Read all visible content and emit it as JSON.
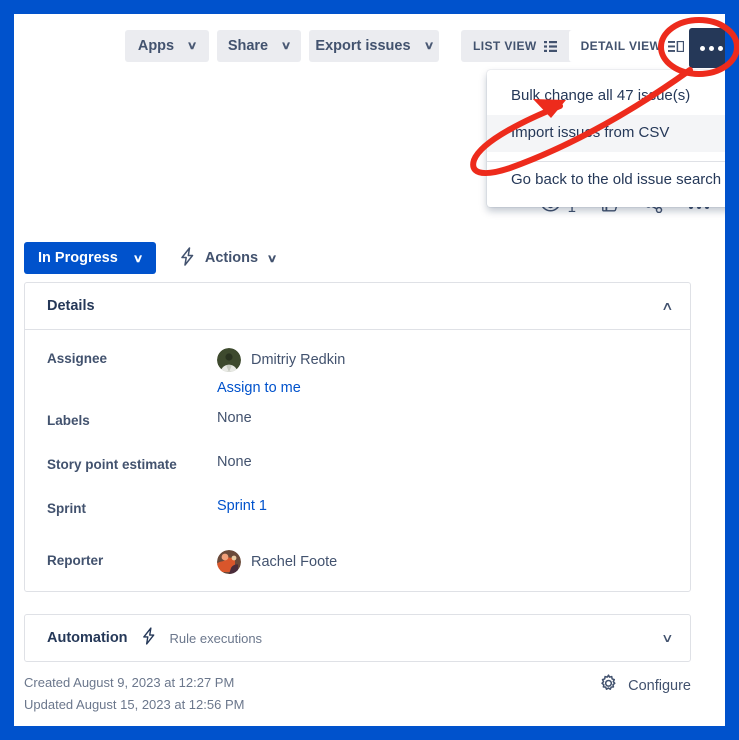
{
  "toolbar": {
    "apps_label": "Apps",
    "share_label": "Share",
    "export_label": "Export issues",
    "list_view_label": "LIST VIEW",
    "detail_view_label": "DETAIL VIEW",
    "chevron": "∨"
  },
  "dropdown": {
    "items": [
      {
        "label": "Bulk change all 47 issue(s)",
        "hover": false
      },
      {
        "label": "Import issues from CSV",
        "hover": true
      },
      {
        "label": "Go back to the old issue search",
        "hover": false
      }
    ]
  },
  "icon_row": {
    "watch_count": "1",
    "watch_icon": "eye-icon",
    "vote_icon": "thumbs-up-icon",
    "share_icon": "share-icon",
    "more_icon": "more-horizontal-icon"
  },
  "status": {
    "status_label": "In Progress",
    "status_color": "#0052CC",
    "actions_label": "Actions",
    "actions_icon": "lightning-bolt-icon",
    "chevron": "∨"
  },
  "details": {
    "title": "Details",
    "collapse_chevron": "∧",
    "fields": [
      {
        "label": "Assignee",
        "value": "Dmitriy Redkin",
        "type": "avatar"
      },
      {
        "label": "Labels",
        "value": "None",
        "type": "text"
      },
      {
        "label": "Story point estimate",
        "value": "None",
        "type": "text"
      },
      {
        "label": "Sprint",
        "value": "Sprint 1",
        "type": "link"
      },
      {
        "label": "Reporter",
        "value": "Rachel Foote",
        "type": "avatar"
      }
    ],
    "assign_to_me_label": "Assign to me"
  },
  "automation": {
    "title": "Automation",
    "rule_label": "Rule executions",
    "icon": "lightning-bolt-icon",
    "expand_chevron": "∨"
  },
  "footer": {
    "created": "Created August 9, 2023 at 12:27 PM",
    "updated": "Updated August 15, 2023 at 12:56 PM",
    "configure_label": "Configure",
    "configure_icon": "gear-icon"
  },
  "annotation": {
    "highlight_color": "#ED2B1C",
    "circle_target": "more-options-button",
    "arrow_target": "bulk-change-menu-item"
  }
}
